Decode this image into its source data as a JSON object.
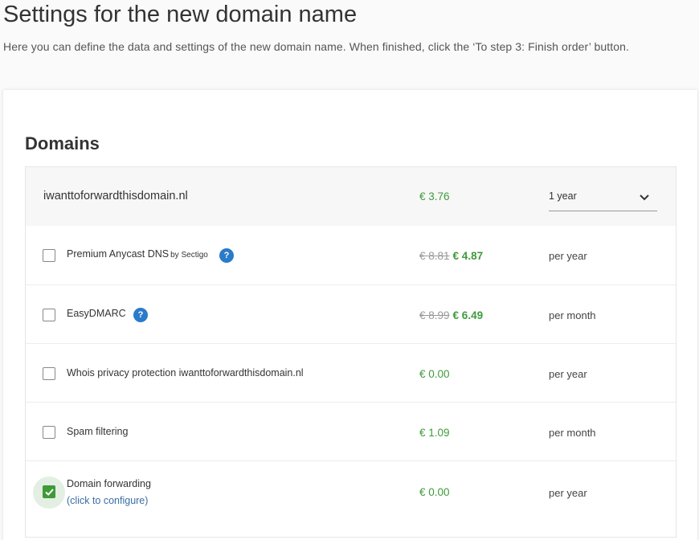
{
  "page": {
    "title": "Settings for the new domain name",
    "subtitle": "Here you can define the data and settings of the new domain name. When finished, click the ‘To step 3: Finish order’ button."
  },
  "section": {
    "title": "Domains"
  },
  "domain": {
    "name": "iwanttoforwardthisdomain.nl",
    "price": "€ 3.76",
    "period_selected": "1 year"
  },
  "options": [
    {
      "label": "Premium Anycast DNS",
      "label_suffix": "by Sectigo",
      "has_help": true,
      "old_price": "€ 8.81",
      "price": "€ 4.87",
      "period": "per year",
      "checked": false
    },
    {
      "label": "EasyDMARC",
      "has_help": true,
      "old_price": "€ 8.99",
      "price": "€ 6.49",
      "period": "per month",
      "checked": false
    },
    {
      "label": "Whois privacy protection iwanttoforwardthisdomain.nl",
      "price": "€ 0.00",
      "period": "per year",
      "checked": false
    },
    {
      "label": "Spam filtering",
      "price": "€ 1.09",
      "period": "per month",
      "checked": false
    },
    {
      "label": "Domain forwarding",
      "link": "(click to configure)",
      "price": "€ 0.00",
      "period": "per year",
      "checked": true
    }
  ],
  "icons": {
    "help": "?",
    "chevron": "chevron-down-icon",
    "check": "checkmark-icon"
  },
  "colors": {
    "price_green": "#3f9a3a",
    "help_blue": "#2a7bc9",
    "link_blue": "#3a6ea5"
  }
}
